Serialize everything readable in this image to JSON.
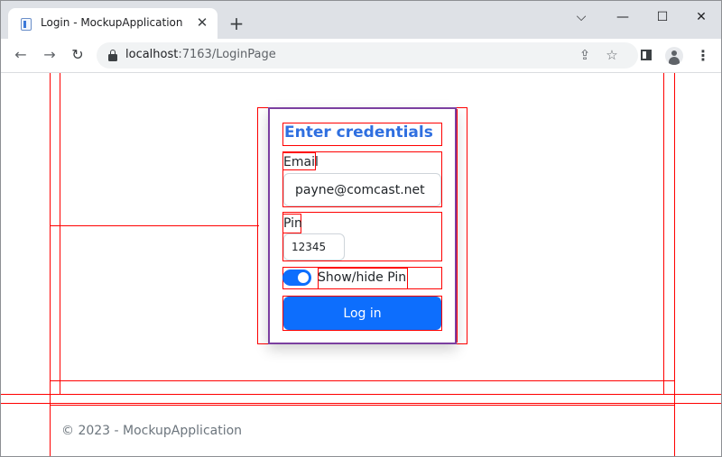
{
  "browser": {
    "tab_title": "Login - MockupApplication",
    "tab_close": "✕",
    "new_tab": "+",
    "url_host": "localhost",
    "url_rest": ":7163/LoginPage",
    "window_minimize": "—",
    "window_restore": "☐",
    "window_close": "✕",
    "dropdown_glyph": "⌵",
    "back_glyph": "←",
    "forward_glyph": "→",
    "reload_glyph": "↻",
    "share_glyph": "⇪",
    "star_glyph": "☆",
    "menu_glyph": "⋮"
  },
  "login": {
    "heading": "Enter credentials",
    "email_label": "Email",
    "email_value": "payne@comcast.net",
    "pin_label": "Pin",
    "pin_value": "12345",
    "toggle_label": "Show/hide Pin",
    "toggle_on": true,
    "submit_label": "Log in"
  },
  "footer": {
    "text": "© 2023 - MockupApplication"
  },
  "colors": {
    "primary": "#0d6efd",
    "heading": "#2f6fe0",
    "debug_outline": "#ff0000",
    "card_border": "#7b3fa0"
  }
}
